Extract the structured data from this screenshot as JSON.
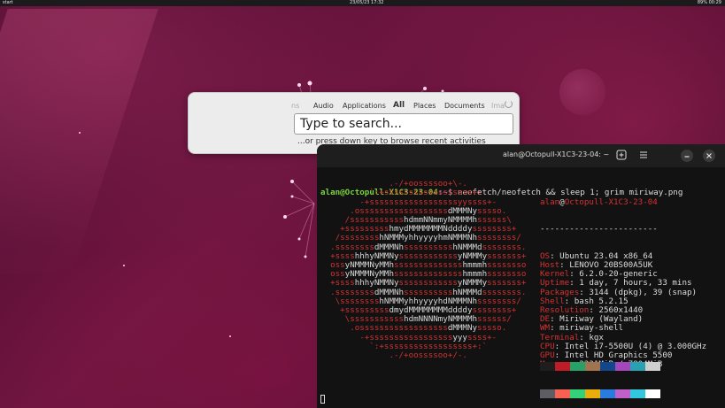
{
  "topbar": {
    "start": "start",
    "clock": "23/05/23 17:32",
    "status": "89% 00:29"
  },
  "launcher": {
    "tabs": [
      {
        "label": "ns",
        "faded": true
      },
      {
        "label": "Audio"
      },
      {
        "label": "Applications"
      },
      {
        "label": "All",
        "active": true
      },
      {
        "label": "Places"
      },
      {
        "label": "Documents"
      },
      {
        "label": "Ima",
        "faded": true
      }
    ],
    "search_placeholder": "Type to search...",
    "hint": "...or press down key to browse recent activities"
  },
  "terminal": {
    "title": "alan@Octopull-X1C3-23-04: ~",
    "buttons": [
      "new-tab",
      "menu",
      "minimize",
      "close"
    ],
    "prompt_user": "alan@Octopull-X1C3-23-04",
    "prompt_path": ":~",
    "prompt_symbol": "$ ",
    "command": "neofetch/neofetch && sleep 1; grim miriway.png",
    "logo_lines": [
      [
        [
          "              ",
          ""
        ],
        [
          ".-/+oossssoo+\\-.",
          "r"
        ]
      ],
      [
        [
          "          ",
          ""
        ],
        [
          "`:+ssssssssssssssssss+:`",
          "r"
        ]
      ],
      [
        [
          "        ",
          ""
        ],
        [
          "-+ssssssssssssssssssyyssss+-",
          "r"
        ]
      ],
      [
        [
          "      ",
          ""
        ],
        [
          ".ossssssssssssssssss",
          "r"
        ],
        [
          "dMMMNy",
          "w"
        ],
        [
          "sssso.",
          "r"
        ]
      ],
      [
        [
          "     ",
          ""
        ],
        [
          "/sssssssssss",
          "r"
        ],
        [
          "hdmmNNmmyNMMMMh",
          "w"
        ],
        [
          "ssssss\\",
          "r"
        ]
      ],
      [
        [
          "    ",
          ""
        ],
        [
          "+sssssssss",
          "r"
        ],
        [
          "hm",
          "w"
        ],
        [
          "yd",
          "r"
        ],
        [
          "MMMMMMMNddddy",
          "w"
        ],
        [
          "ssssssss+",
          "r"
        ]
      ],
      [
        [
          "   ",
          ""
        ],
        [
          "/ssssssss",
          "r"
        ],
        [
          "hNMMM",
          "w"
        ],
        [
          "yh",
          "r"
        ],
        [
          "hyyyyhmNMMMNh",
          "w"
        ],
        [
          "ssssssss/",
          "r"
        ]
      ]
    ],
    "logo_text": [
      "              .-/+oossssoo+\\-.",
      "          `:+ssssssssssssssssss+:`",
      "        -+ssssssssssssssssssyyssss+-",
      "      .ossssssssssssssssssdMMMNysssso.",
      "     /ssssssssssshdmmNNmmyNMMMMhssssss\\",
      "    +ssssssssshmydMMMMMMMNddddyssssssss+",
      "   /sssssssshNMMMyhhyyyyhmNMMMNhssssssss/",
      "  .ssssssssdMMMNhsssssssssshNMMMdssssssss.",
      "  +sssshhhyNMMNyssssssssssssyNMMMysssssss+",
      "  ossyNMMMNyMMhsssssssssssssshmmmhssssssso",
      "  ossyNMMMNyMMhsssssssssssssshmmmhssssssso",
      "  +sssshhhyNMMNyssssssssssssyNMMMysssssss+",
      "  .ssssssssdMMMNhsssssssssshNMMMdssssssss.",
      "   \\sssssssshNMMMyhhyyyyhdNMMMNhssssssss/",
      "    +sssssssssdmydMMMMMMMMddddyssssssss+",
      "     \\ssssssssssshdmNNNNmyNMMMMhssssss/",
      "      .ossssssssssssssssssdMMMNysssso.",
      "        -+sssssssssssssssssyyyssss+-",
      "          `:+ssssssssssssssssss+:`",
      "              .-/+oossssoo+/-."
    ],
    "info_header_user": "alan",
    "info_header_host": "Octopull-X1C3-23-04",
    "info_separator": "------------------------",
    "info": [
      {
        "key": "OS",
        "value": "Ubuntu 23.04 x86_64"
      },
      {
        "key": "Host",
        "value": "LENOVO 20BS00A5UK"
      },
      {
        "key": "Kernel",
        "value": "6.2.0-20-generic"
      },
      {
        "key": "Uptime",
        "value": "1 day, 7 hours, 33 mins"
      },
      {
        "key": "Packages",
        "value": "3144 (dpkg), 39 (snap)"
      },
      {
        "key": "Shell",
        "value": "bash 5.2.15"
      },
      {
        "key": "Resolution",
        "value": "2560x1440"
      },
      {
        "key": "DE",
        "value": "Miriway (Wayland)"
      },
      {
        "key": "WM",
        "value": "miriway-shell"
      },
      {
        "key": "Terminal",
        "value": "kgx"
      },
      {
        "key": "CPU",
        "value": "Intel i7-5500U (4) @ 3.000GHz"
      },
      {
        "key": "GPU",
        "value": "Intel HD Graphics 5500"
      },
      {
        "key": "Memory",
        "value": "2231MiB / 7804MiB"
      }
    ],
    "palette_row1": [
      "#1e1e1e",
      "#c01c28",
      "#26a269",
      "#a2734c",
      "#12488b",
      "#a347ba",
      "#2aa1b3",
      "#cfcfcf"
    ],
    "palette_row2": [
      "#5e5c64",
      "#f66151",
      "#33d17a",
      "#e9ad0c",
      "#2a7bde",
      "#c061cb",
      "#33c7de",
      "#ffffff"
    ]
  },
  "colors": {
    "accent_red": "#d43232",
    "prompt_green": "#7bd33e",
    "prompt_blue": "#5b8fd6"
  }
}
